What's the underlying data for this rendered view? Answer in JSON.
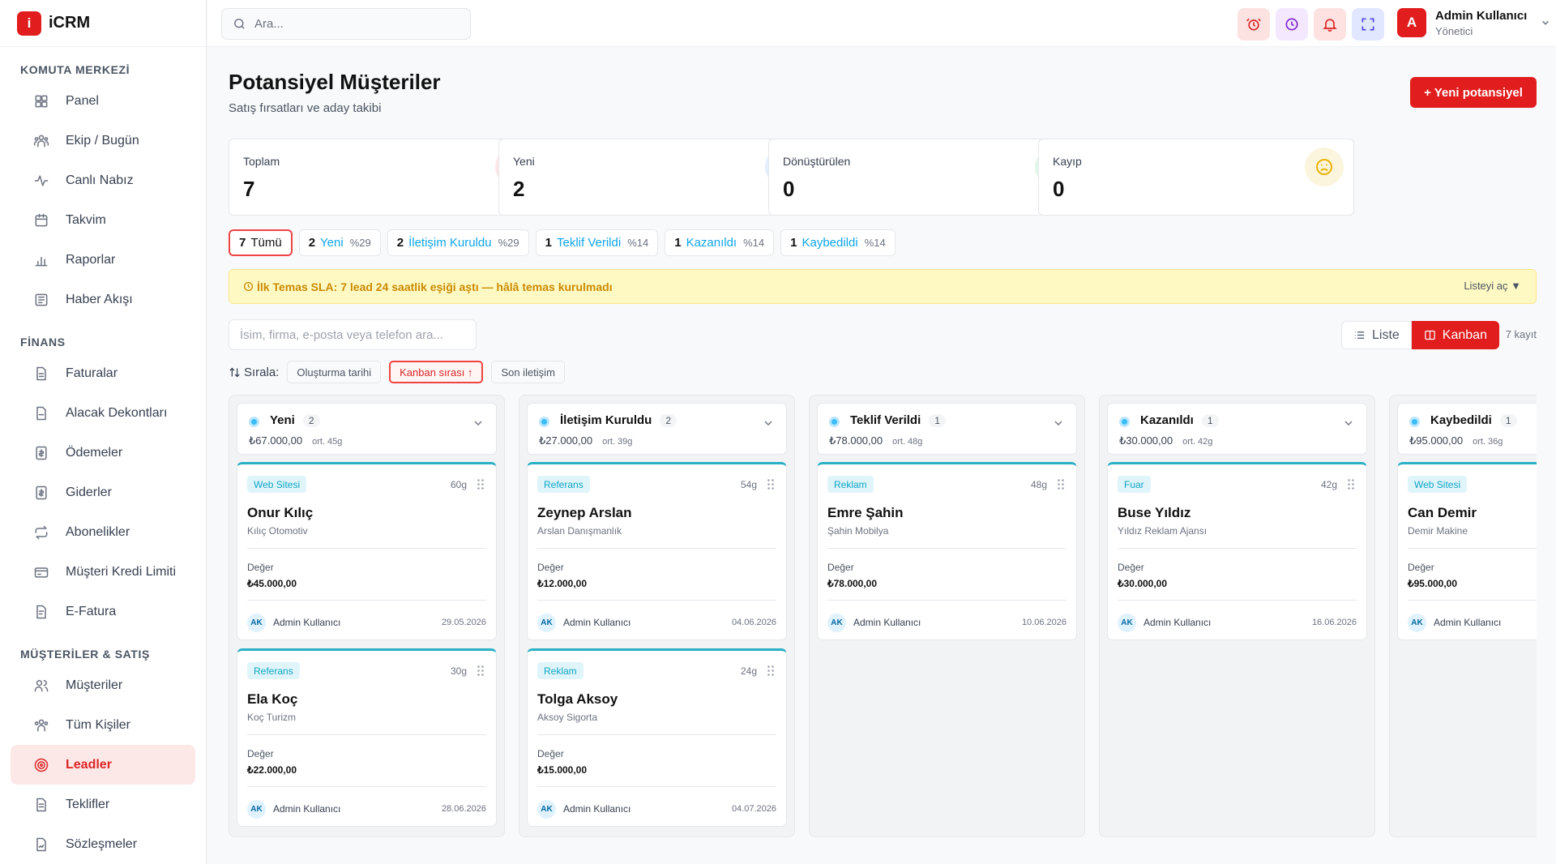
{
  "app": {
    "logo_letter": "i",
    "name": "iCRM"
  },
  "sidebar": {
    "sections": [
      {
        "title": "KOMUTA MERKEZİ",
        "items": [
          {
            "label": "Panel",
            "icon": "grid-icon"
          },
          {
            "label": "Ekip / Bugün",
            "icon": "team-icon"
          },
          {
            "label": "Canlı Nabız",
            "icon": "pulse-icon"
          },
          {
            "label": "Takvim",
            "icon": "calendar-icon"
          },
          {
            "label": "Raporlar",
            "icon": "bar-chart-icon"
          },
          {
            "label": "Haber Akışı",
            "icon": "newspaper-icon"
          }
        ]
      },
      {
        "title": "FİNANS",
        "items": [
          {
            "label": "Faturalar",
            "icon": "file-icon"
          },
          {
            "label": "Alacak Dekontları",
            "icon": "file-minus-icon"
          },
          {
            "label": "Ödemeler",
            "icon": "payment-icon"
          },
          {
            "label": "Giderler",
            "icon": "expense-icon"
          },
          {
            "label": "Abonelikler",
            "icon": "repeat-icon"
          },
          {
            "label": "Müşteri Kredi Limiti",
            "icon": "credit-card-icon"
          },
          {
            "label": "E-Fatura",
            "icon": "e-invoice-icon"
          }
        ]
      },
      {
        "title": "MÜŞTERİLER & SATIŞ",
        "items": [
          {
            "label": "Müşteriler",
            "icon": "users-icon"
          },
          {
            "label": "Tüm Kişiler",
            "icon": "contacts-icon"
          },
          {
            "label": "Leadler",
            "icon": "target-icon",
            "active": true
          },
          {
            "label": "Teklifler",
            "icon": "document-icon"
          },
          {
            "label": "Sözleşmeler",
            "icon": "contract-icon"
          }
        ]
      }
    ]
  },
  "topbar": {
    "search_placeholder": "Ara...",
    "user": {
      "initial": "A",
      "name": "Admin Kullanıcı",
      "role": "Yönetici"
    }
  },
  "page": {
    "title": "Potansiyel Müşteriler",
    "subtitle": "Satış fırsatları ve aday takibi",
    "new_button": "+ Yeni potansiyel"
  },
  "stats": [
    {
      "label": "Toplam",
      "value": "7",
      "icon": "users-icon",
      "color": "#ef4444"
    },
    {
      "label": "Yeni",
      "value": "2",
      "icon": "sparkles-icon",
      "color": "#3b82f6"
    },
    {
      "label": "Dönüştürülen",
      "value": "0",
      "icon": "user-check-icon",
      "color": "#22c55e"
    },
    {
      "label": "Kayıp",
      "value": "0",
      "icon": "frown-icon",
      "color": "#eab308"
    }
  ],
  "filters": [
    {
      "count": "7",
      "label": "Tümü",
      "pct": "",
      "active": true
    },
    {
      "count": "2",
      "label": "Yeni",
      "pct": "%29"
    },
    {
      "count": "2",
      "label": "İletişim Kuruldu",
      "pct": "%29"
    },
    {
      "count": "1",
      "label": "Teklif Verildi",
      "pct": "%14"
    },
    {
      "count": "1",
      "label": "Kazanıldı",
      "pct": "%14"
    },
    {
      "count": "1",
      "label": "Kaybedildi",
      "pct": "%14"
    }
  ],
  "sla": {
    "text": "İlk Temas SLA: 7 lead 24 saatlik eşiği aştı — hâlâ temas kurulmadı",
    "action": "Listeyi aç ▼"
  },
  "list_search_placeholder": "İsim, firma, e-posta veya telefon ara...",
  "view": {
    "list_label": "Liste",
    "kanban_label": "Kanban",
    "record_count": "7 kayıt"
  },
  "sort": {
    "label": "Sırala:",
    "options": [
      "Oluşturma tarihi",
      "Kanban sırası ↑",
      "Son iletişim"
    ],
    "active_index": 1
  },
  "columns": [
    {
      "name": "Yeni",
      "count": "2",
      "total": "₺67.000,00",
      "avg": "ort. 45g",
      "cards": [
        {
          "source": "Web Sitesi",
          "age": "60g",
          "name": "Onur Kılıç",
          "company": "Kılıç Otomotiv",
          "value_label": "Değer",
          "value": "₺45.000,00",
          "owner_initials": "AK",
          "owner": "Admin Kullanıcı",
          "date": "29.05.2026"
        },
        {
          "source": "Referans",
          "age": "30g",
          "name": "Ela Koç",
          "company": "Koç Turizm",
          "value_label": "Değer",
          "value": "₺22.000,00",
          "owner_initials": "AK",
          "owner": "Admin Kullanıcı",
          "date": "28.06.2026"
        }
      ]
    },
    {
      "name": "İletişim Kuruldu",
      "count": "2",
      "total": "₺27.000,00",
      "avg": "ort. 39g",
      "cards": [
        {
          "source": "Referans",
          "age": "54g",
          "name": "Zeynep Arslan",
          "company": "Arslan Danışmanlık",
          "value_label": "Değer",
          "value": "₺12.000,00",
          "owner_initials": "AK",
          "owner": "Admin Kullanıcı",
          "date": "04.06.2026"
        },
        {
          "source": "Reklam",
          "age": "24g",
          "name": "Tolga Aksoy",
          "company": "Aksoy Sigorta",
          "value_label": "Değer",
          "value": "₺15.000,00",
          "owner_initials": "AK",
          "owner": "Admin Kullanıcı",
          "date": "04.07.2026"
        }
      ]
    },
    {
      "name": "Teklif Verildi",
      "count": "1",
      "total": "₺78.000,00",
      "avg": "ort. 48g",
      "cards": [
        {
          "source": "Reklam",
          "age": "48g",
          "name": "Emre Şahin",
          "company": "Şahin Mobilya",
          "value_label": "Değer",
          "value": "₺78.000,00",
          "owner_initials": "AK",
          "owner": "Admin Kullanıcı",
          "date": "10.06.2026"
        }
      ]
    },
    {
      "name": "Kazanıldı",
      "count": "1",
      "total": "₺30.000,00",
      "avg": "ort. 42g",
      "cards": [
        {
          "source": "Fuar",
          "age": "42g",
          "name": "Buse Yıldız",
          "company": "Yıldız Reklam Ajansı",
          "value_label": "Değer",
          "value": "₺30.000,00",
          "owner_initials": "AK",
          "owner": "Admin Kullanıcı",
          "date": "16.06.2026"
        }
      ]
    },
    {
      "name": "Kaybedildi",
      "count": "1",
      "total": "₺95.000,00",
      "avg": "ort. 36g",
      "cards": [
        {
          "source": "Web Sitesi",
          "age": "",
          "name": "Can Demir",
          "company": "Demir Makine",
          "value_label": "Değer",
          "value": "₺95.000,00",
          "owner_initials": "AK",
          "owner": "Admin Kullanıcı",
          "date": ""
        }
      ]
    }
  ]
}
